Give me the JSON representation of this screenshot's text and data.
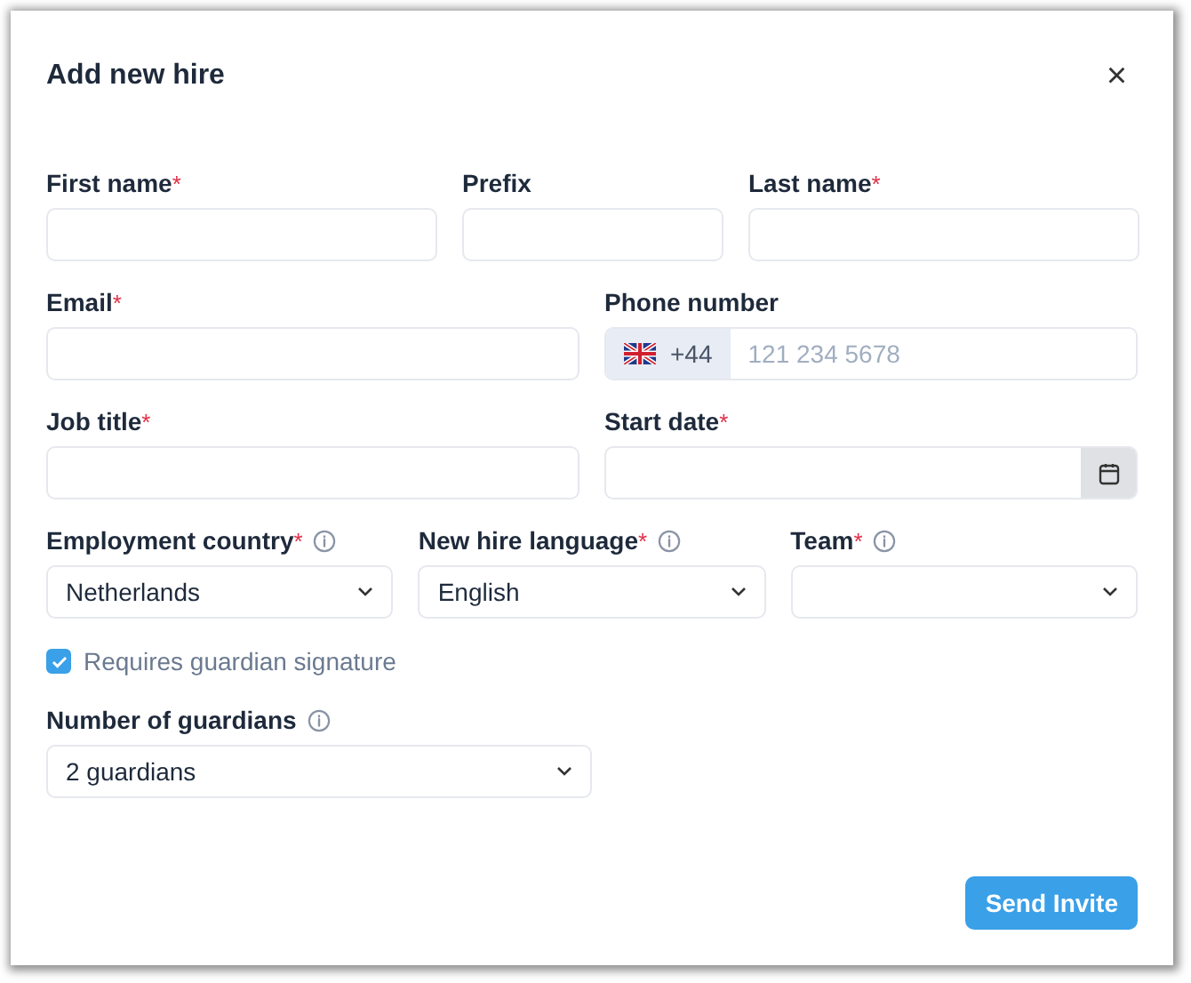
{
  "dialog": {
    "title": "Add new hire",
    "close": "×"
  },
  "rows": [
    {
      "fields": [
        {
          "kind": "text",
          "label": "First name",
          "required_mark": "*",
          "info": false
        },
        {
          "kind": "text",
          "label": "Prefix",
          "info": false
        },
        {
          "kind": "text",
          "label": "Last name",
          "required_mark": "*",
          "info": false
        }
      ]
    },
    {
      "fields": [
        {
          "kind": "text",
          "label": "Email",
          "required_mark": "*",
          "info": false
        },
        {
          "kind": "phone",
          "label": "Phone number",
          "info": false,
          "dial_code": "+44",
          "placeholder": "121 234 5678"
        }
      ]
    },
    {
      "fields": [
        {
          "kind": "text",
          "label": "Job title",
          "required_mark": "*",
          "info": false
        },
        {
          "kind": "date",
          "label": "Start date",
          "required_mark": "*",
          "info": false
        }
      ]
    },
    {
      "fields": [
        {
          "kind": "select",
          "label": "Employment country",
          "required_mark": "*",
          "info": true,
          "value": "Netherlands"
        },
        {
          "kind": "select",
          "label": "New hire language",
          "required_mark": "*",
          "info": true,
          "value": "English"
        },
        {
          "kind": "select",
          "label": "Team",
          "required_mark": "*",
          "info": true
        }
      ]
    }
  ],
  "checkbox": {
    "label": "Requires guardian signature",
    "checked": true
  },
  "guardians": {
    "kind": "select",
    "label": "Number of guardians",
    "info": true,
    "value": "2 guardians"
  },
  "submit": "Send Invite"
}
